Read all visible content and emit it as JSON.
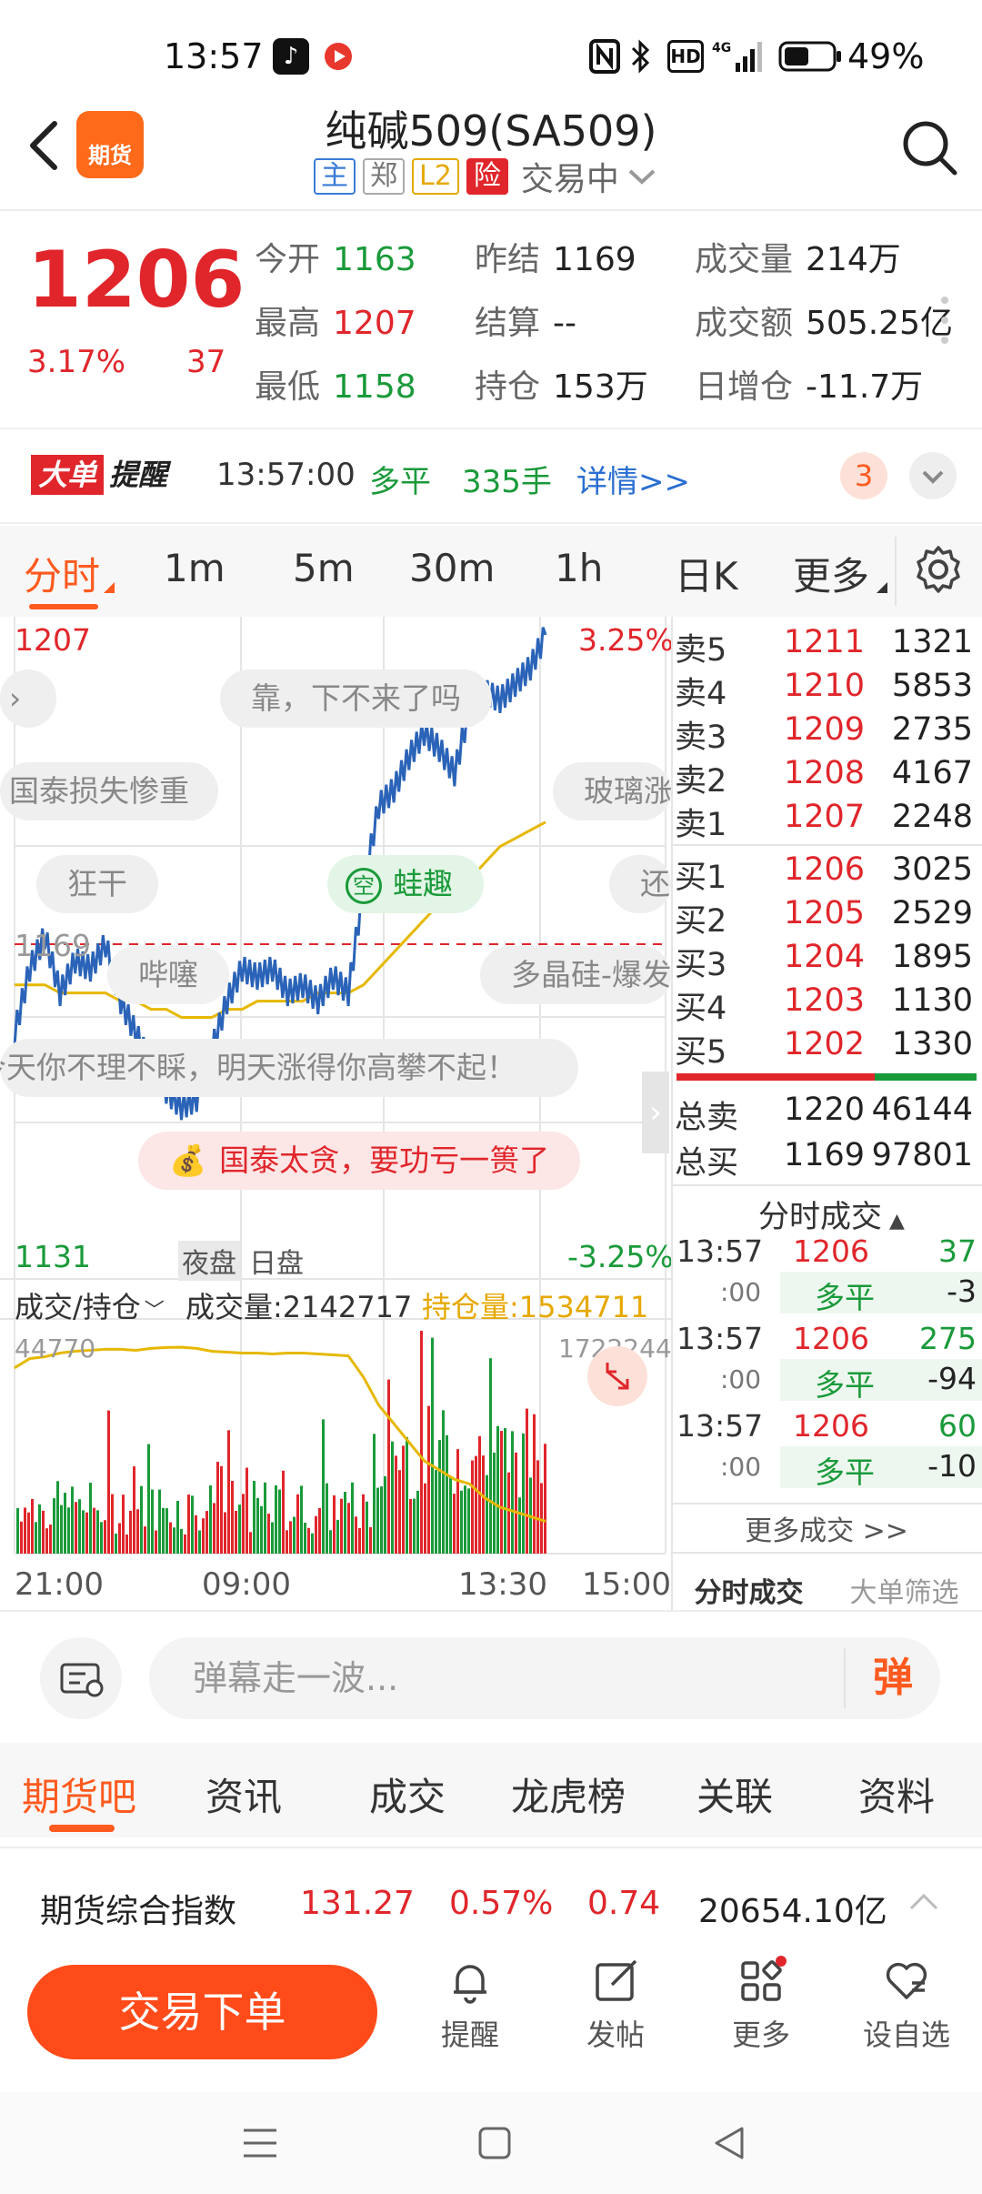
{
  "status_bar": {
    "time": "13:57",
    "battery": "49%",
    "network": "4G",
    "hd": "HD"
  },
  "header": {
    "app_logo": "期货",
    "title": "纯碱509(SA509)",
    "tags": [
      "主",
      "郑",
      "L2",
      "险"
    ],
    "trade_status": "交易中"
  },
  "quote": {
    "price": "1206",
    "change_pct": "3.17%",
    "change_abs": "37",
    "stats": [
      {
        "label": "今开",
        "value": "1163",
        "tone": "green"
      },
      {
        "label": "昨结",
        "value": "1169",
        "tone": "dark"
      },
      {
        "label": "成交量",
        "value": "214万",
        "tone": "dark"
      },
      {
        "label": "最高",
        "value": "1207",
        "tone": "red"
      },
      {
        "label": "结算",
        "value": "--",
        "tone": "dark"
      },
      {
        "label": "成交额",
        "value": "505.25亿",
        "tone": "dark"
      },
      {
        "label": "最低",
        "value": "1158",
        "tone": "green"
      },
      {
        "label": "持仓",
        "value": "153万",
        "tone": "dark"
      },
      {
        "label": "日增仓",
        "value": "-11.7万",
        "tone": "dark"
      }
    ]
  },
  "alert": {
    "logo_part1": "大单",
    "logo_part2": "提醒",
    "time": "13:57:00",
    "type": "多平",
    "lots": "335手",
    "detail": "详情>>",
    "count": "3"
  },
  "period_tabs": [
    "分时",
    "1m",
    "5m",
    "30m",
    "1h",
    "日K",
    "更多"
  ],
  "chart": {
    "y_high": "1207",
    "y_low": "1131",
    "y_ref": "1169",
    "pct_high": "3.25%",
    "pct_low": "-3.25%",
    "session_labels": [
      "夜盘",
      "日盘"
    ],
    "vol_selector": "成交/持仓",
    "vol_label": "成交量:2142717",
    "oi_label": "持仓量:1534711",
    "vol_axis_left": "44770",
    "vol_axis_right": "1722244",
    "x_labels": [
      "21:00",
      "09:00",
      "13:30",
      "15:00"
    ],
    "danmaku": {
      "b1": "靠，下不来了吗",
      "b2": "国泰损失惨重",
      "b3": "玻璃涨",
      "b4": "狂干",
      "b5": "蛙趣",
      "b5_icon": "空",
      "b6": "还",
      "b7": "哔噻",
      "b8": "多晶硅-爆发",
      "b9": "今天你不理不睬，明天涨得你高攀不起！",
      "b10": "国泰太贪，要功亏一篑了"
    }
  },
  "chart_data": {
    "type": "line",
    "price_range": [
      1131,
      1207
    ],
    "reference": 1169,
    "price_series": [
      1158,
      1166,
      1170,
      1163,
      1167,
      1166,
      1169,
      1162,
      1158,
      1154,
      1151,
      1149,
      1150,
      1156,
      1162,
      1166,
      1165,
      1166,
      1163,
      1164,
      1162,
      1165,
      1163,
      1176,
      1186,
      1188,
      1192,
      1195,
      1193,
      1190,
      1198,
      1200,
      1199,
      1201,
      1203,
      1207
    ],
    "avg_series": [
      1164,
      1164,
      1164,
      1163,
      1163,
      1163,
      1163,
      1162,
      1162,
      1161,
      1161,
      1160,
      1160,
      1160,
      1161,
      1161,
      1162,
      1162,
      1162,
      1162,
      1163,
      1163,
      1163,
      1164,
      1166,
      1168,
      1170,
      1172,
      1174,
      1176,
      1177,
      1179,
      1181,
      1182,
      1183,
      1184
    ],
    "oi_series": [
      1700000,
      1710000,
      1712000,
      1716000,
      1718000,
      1719000,
      1720000,
      1720000,
      1719000,
      1721000,
      1722000,
      1722244,
      1721000,
      1718000,
      1717000,
      1716000,
      1716000,
      1715000,
      1716000,
      1716000,
      1715000,
      1714000,
      1713000,
      1690000,
      1660000,
      1640000,
      1620000,
      1600000,
      1590000,
      1580000,
      1575000,
      1560000,
      1550000,
      1545000,
      1540000,
      1534711
    ],
    "volume_max": 44770
  },
  "order_book": {
    "sell": [
      {
        "label": "卖5",
        "price": "1211",
        "vol": "1321"
      },
      {
        "label": "卖4",
        "price": "1210",
        "vol": "5853"
      },
      {
        "label": "卖3",
        "price": "1209",
        "vol": "2735"
      },
      {
        "label": "卖2",
        "price": "1208",
        "vol": "4167"
      },
      {
        "label": "卖1",
        "price": "1207",
        "vol": "2248"
      }
    ],
    "buy": [
      {
        "label": "买1",
        "price": "1206",
        "vol": "3025"
      },
      {
        "label": "买2",
        "price": "1205",
        "vol": "2529"
      },
      {
        "label": "买3",
        "price": "1204",
        "vol": "1895"
      },
      {
        "label": "买4",
        "price": "1203",
        "vol": "1130"
      },
      {
        "label": "买5",
        "price": "1202",
        "vol": "1330"
      }
    ],
    "total_sell": {
      "label": "总卖",
      "price": "1220",
      "vol": "46144"
    },
    "total_buy": {
      "label": "总买",
      "price": "1169",
      "vol": "97801"
    }
  },
  "trades": {
    "title": "分时成交",
    "rows": [
      {
        "time": "13:57",
        "sec": ":00",
        "price": "1206",
        "vol": "37",
        "type": "多平",
        "oi": "-3"
      },
      {
        "time": "13:57",
        "sec": ":00",
        "price": "1206",
        "vol": "275",
        "type": "多平",
        "oi": "-94"
      },
      {
        "time": "13:57",
        "sec": ":00",
        "price": "1206",
        "vol": "60",
        "type": "多平",
        "oi": "-10"
      }
    ],
    "more": "更多成交 >>",
    "tab1": "分时成交",
    "tab2": "大单筛选"
  },
  "danmaku_input": {
    "placeholder": "弹幕走一波...",
    "send": "弹"
  },
  "bottom_tabs": [
    "期货吧",
    "资讯",
    "成交",
    "龙虎榜",
    "关联",
    "资料"
  ],
  "index_row": {
    "name": "期货综合指数",
    "value": "131.27",
    "pct": "0.57%",
    "change": "0.74",
    "amount": "20654.10亿"
  },
  "bottom_bar": {
    "trade_button": "交易下单",
    "nav": [
      "提醒",
      "发帖",
      "更多",
      "设自选"
    ]
  },
  "colors": {
    "accent": "#ff5a1f",
    "up": "#e0262b",
    "down": "#1a9a3a",
    "price_line": "#2a63b8",
    "avg_line": "#e6b800"
  }
}
